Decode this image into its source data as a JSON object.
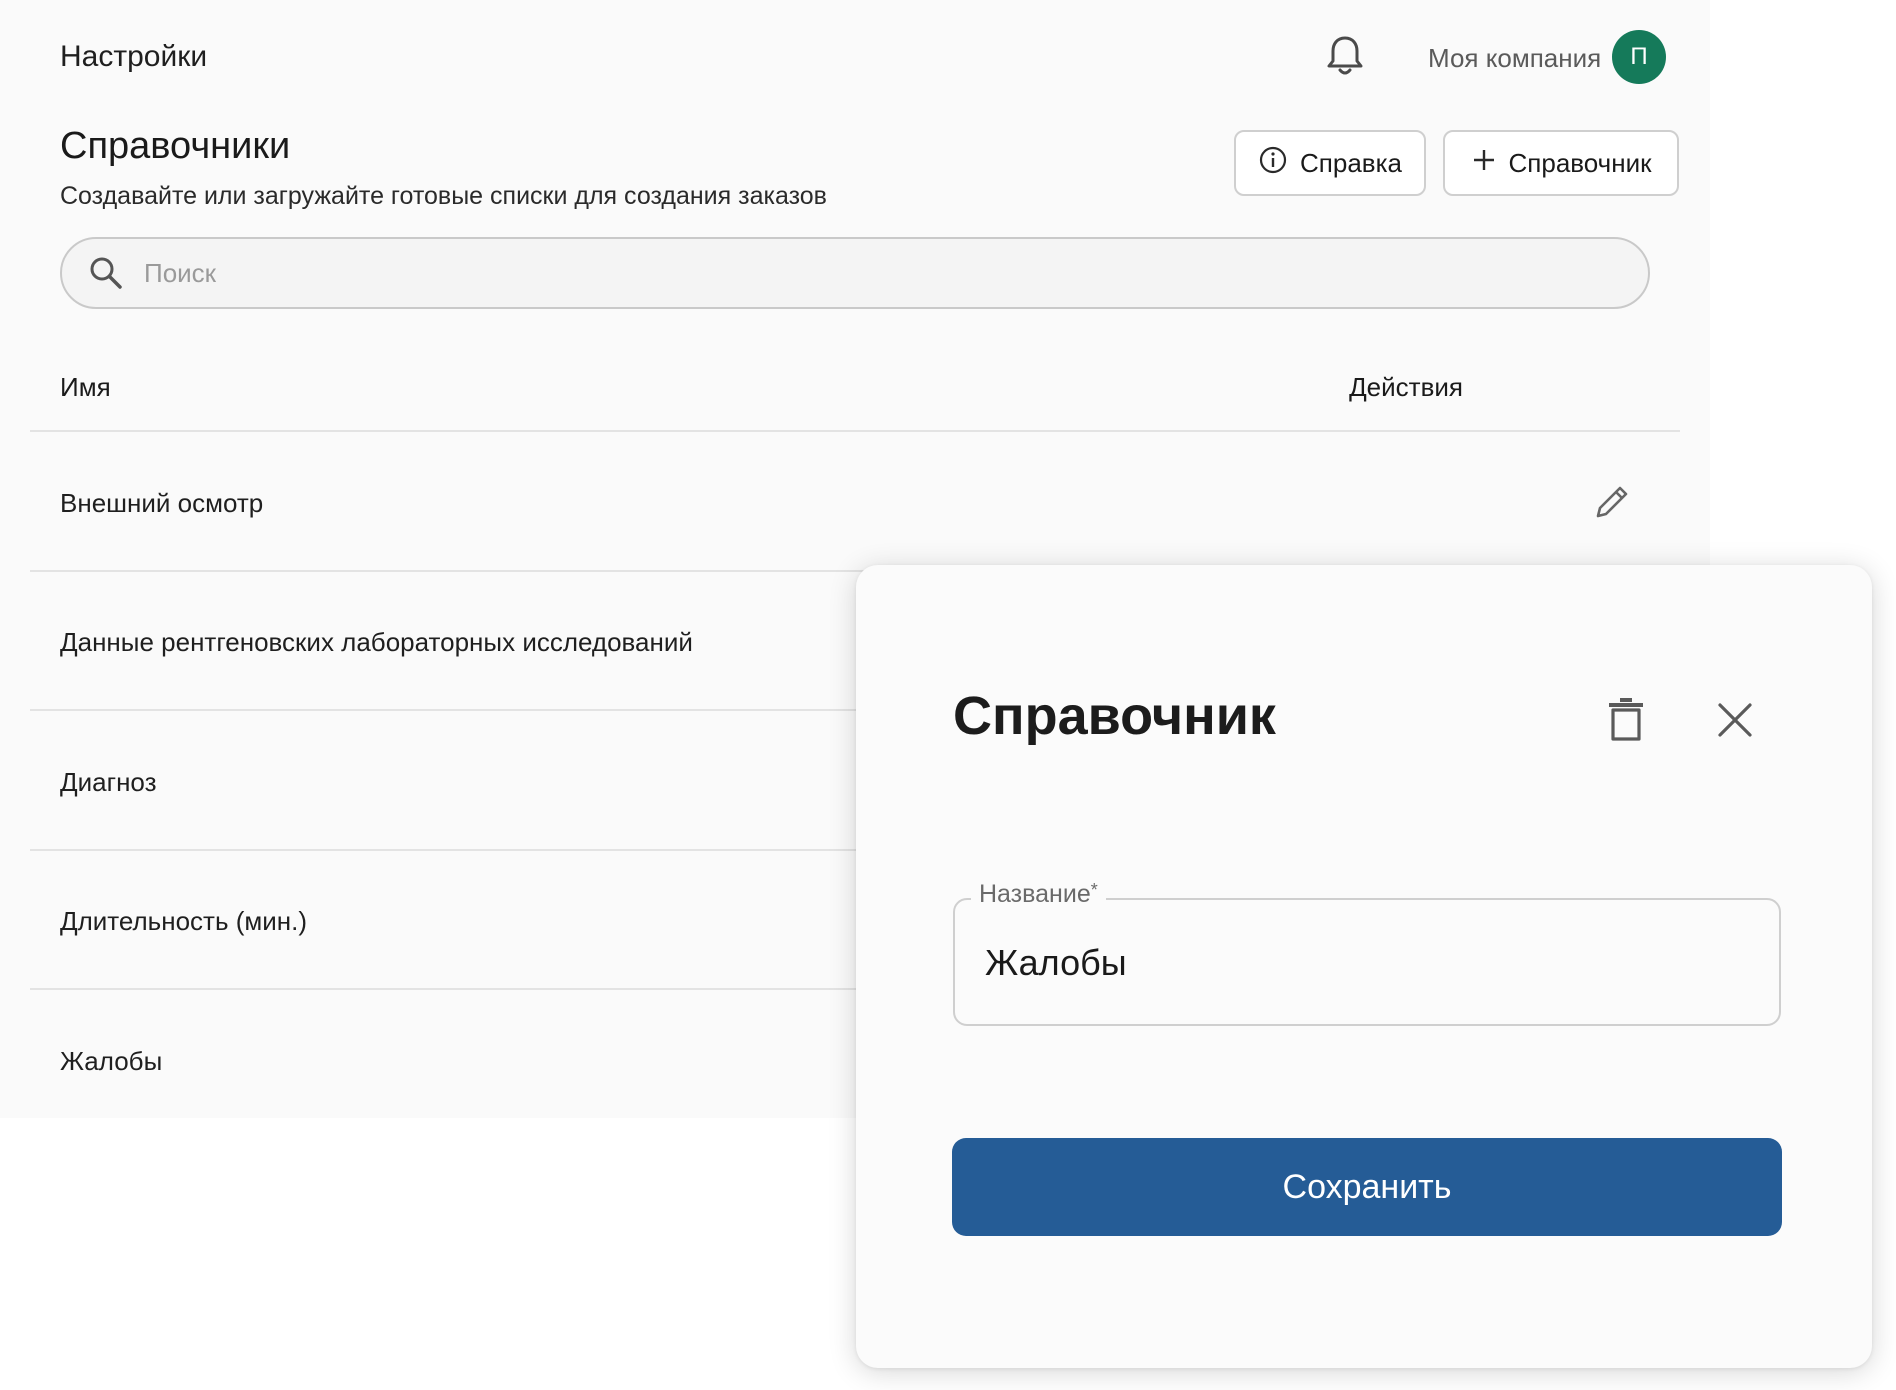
{
  "topbar": {
    "title": "Настройки",
    "company_name": "Моя компания",
    "avatar_initial": "П",
    "avatar_color": "#157a5a"
  },
  "header": {
    "title": "Справочники",
    "subtitle": "Создавайте или загружайте готовые списки для создания заказов",
    "help_button": "Справка",
    "add_button": "Справочник"
  },
  "search": {
    "placeholder": "Поиск",
    "value": ""
  },
  "table": {
    "columns": [
      "Имя",
      "Действия"
    ],
    "rows": [
      {
        "name": "Внешний осмотр"
      },
      {
        "name": "Данные рентгеновских лабораторных исследований"
      },
      {
        "name": "Диагноз"
      },
      {
        "name": "Длительность (мин.)"
      },
      {
        "name": "Жалобы"
      }
    ]
  },
  "panel": {
    "title": "Справочник",
    "field_label": "Название",
    "field_required_mark": "*",
    "field_value": "Жалобы",
    "save_button": "Сохранить",
    "save_color": "#255c96"
  },
  "icons": [
    "bell-icon",
    "info-icon",
    "plus-icon",
    "search-icon",
    "pencil-icon",
    "trash-icon",
    "close-icon"
  ]
}
